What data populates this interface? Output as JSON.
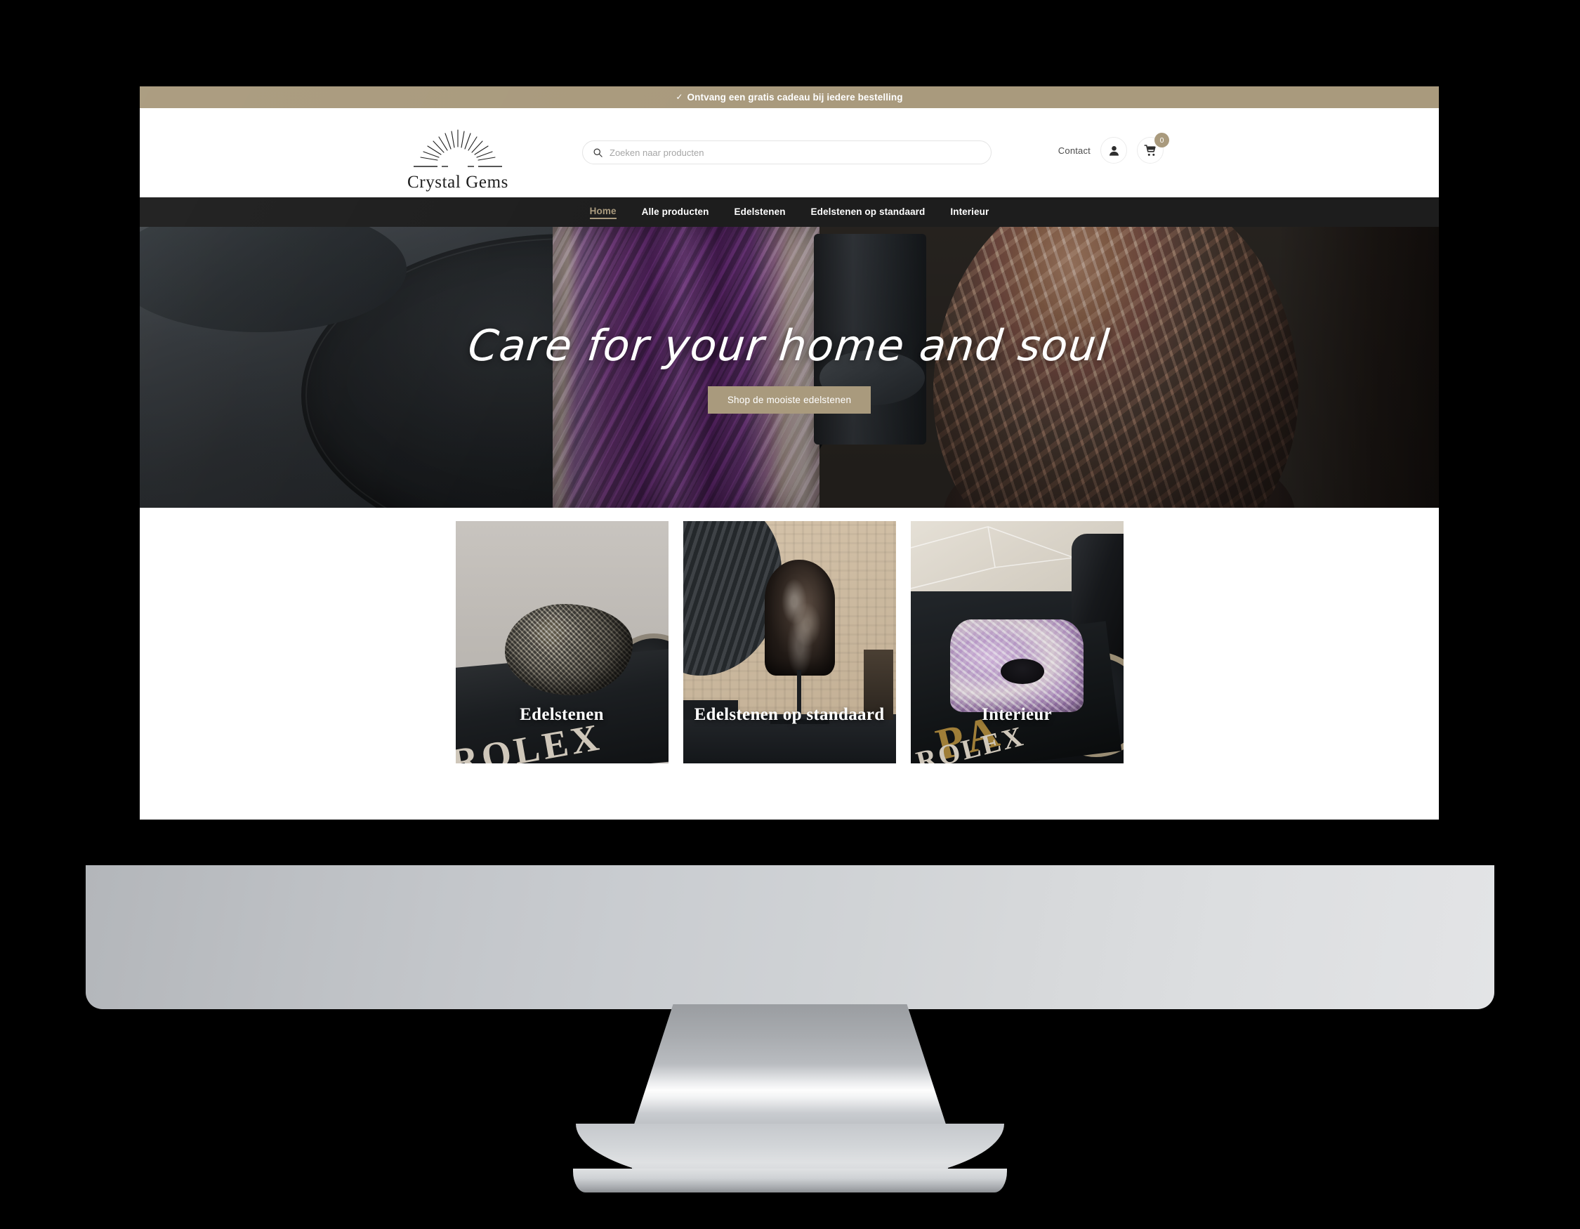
{
  "promo": {
    "check_icon": "check-icon",
    "text": "Ontvang een gratis cadeau bij iedere bestelling"
  },
  "brand": {
    "name": "Crystal Gems",
    "logo_icon": "sunburst-icon"
  },
  "search": {
    "placeholder": "Zoeken naar producten",
    "value": "",
    "icon": "search-icon"
  },
  "header": {
    "contact_label": "Contact",
    "account_icon": "user-icon",
    "cart_icon": "shopping-cart-icon",
    "cart_count": "0"
  },
  "nav": {
    "items": [
      {
        "label": "Home",
        "active": true
      },
      {
        "label": "Alle producten",
        "active": false
      },
      {
        "label": "Edelstenen",
        "active": false
      },
      {
        "label": "Edelstenen op standaard",
        "active": false
      },
      {
        "label": "Interieur",
        "active": false
      }
    ]
  },
  "hero": {
    "title": "Care for your home and soul",
    "cta_label": "Shop de mooiste edelstenen"
  },
  "categories": [
    {
      "label": "Edelstenen"
    },
    {
      "label": "Edelstenen op standaard"
    },
    {
      "label": "Interieur"
    }
  ],
  "colors": {
    "accent": "#a99a7d",
    "nav_background": "#1d1d1d",
    "page_background": "#ffffff"
  },
  "card_art": {
    "rolex_text": "ROLEX",
    "rolex_text_short": "ROLEX",
    "gold_text": "PA"
  }
}
